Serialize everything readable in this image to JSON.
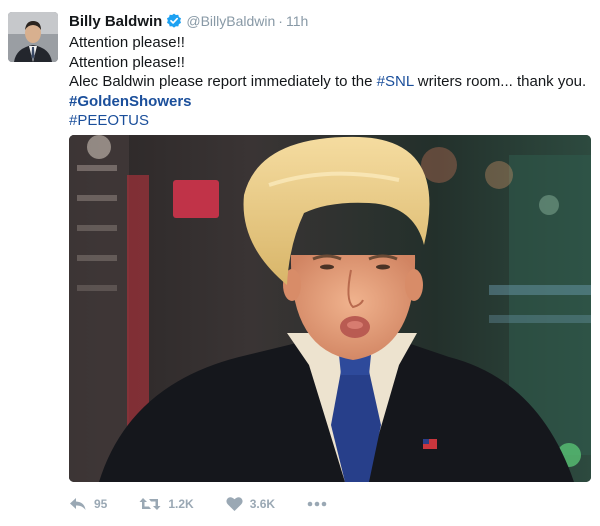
{
  "tweet": {
    "author": {
      "display_name": "Billy Baldwin",
      "handle": "@BillyBaldwin",
      "verified": true
    },
    "separator": "·",
    "time": "11h",
    "lines": {
      "l1": "Attention please!!",
      "l2": "Attention please!!",
      "l3_text": "Alec Baldwin please report immediately to the ",
      "l3_hashtag": "#SNL",
      "l3_tail": " writers room... thank you.",
      "hashtag1": "#GoldenShowers",
      "hashtag2": "#PEEOTUS"
    },
    "actions": {
      "reply_icon": "reply-icon",
      "replies": "95",
      "retweet_icon": "retweet-icon",
      "retweets": "1.2K",
      "like_icon": "heart-icon",
      "likes": "3.6K",
      "more_icon": "more-dots-icon"
    }
  },
  "colors": {
    "text": "#14171a",
    "secondary": "#8899a6",
    "link": "#1b4f9b",
    "verified": "#1da1f2",
    "action": "#9aa8b4"
  }
}
